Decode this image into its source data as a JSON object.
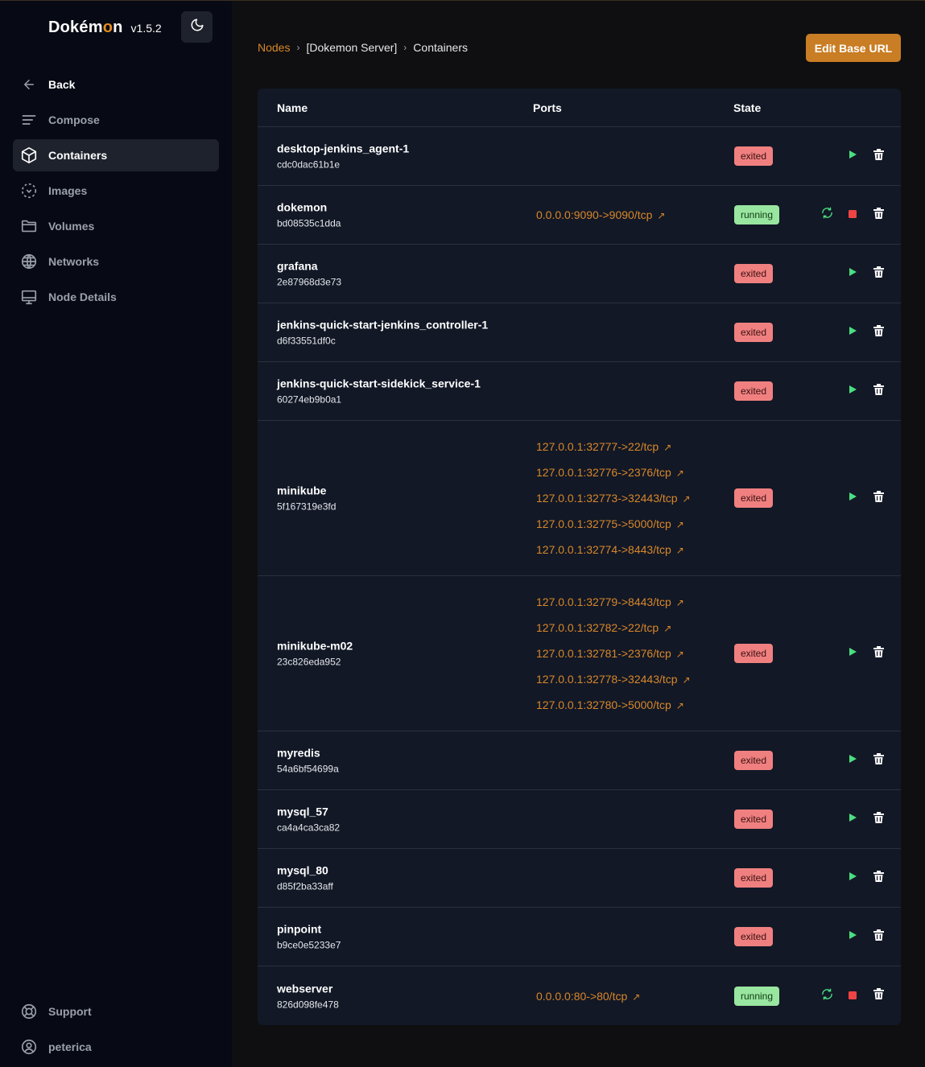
{
  "app": {
    "name_pre": "Dok",
    "name_accent": "é",
    "name_mid": "m",
    "name_o": "o",
    "name_post": "n",
    "version": "v1.5.2"
  },
  "colors": {
    "accent": "#d8872a",
    "exited": "#f08080",
    "running": "#99e6a0",
    "play": "#4ade80",
    "stop": "#ef4444"
  },
  "sidebar": {
    "items": [
      {
        "label": "Back",
        "icon": "arrow-left-icon"
      },
      {
        "label": "Compose",
        "icon": "lines-icon"
      },
      {
        "label": "Containers",
        "icon": "cube-icon",
        "active": true
      },
      {
        "label": "Images",
        "icon": "dashed-image-icon"
      },
      {
        "label": "Volumes",
        "icon": "folder-icon"
      },
      {
        "label": "Networks",
        "icon": "globe-icon"
      },
      {
        "label": "Node Details",
        "icon": "monitor-icon"
      }
    ],
    "bottom": [
      {
        "label": "Support",
        "icon": "lifebuoy-icon"
      },
      {
        "label": "peterica",
        "icon": "user-circle-icon"
      }
    ]
  },
  "breadcrumb": {
    "nodes": "Nodes",
    "server": "[Dokemon Server]",
    "current": "Containers"
  },
  "edit_button": "Edit Base URL",
  "table": {
    "headers": {
      "name": "Name",
      "ports": "Ports",
      "state": "State"
    },
    "rows": [
      {
        "name": "desktop-jenkins_agent-1",
        "id": "cdc0dac61b1e",
        "ports": [],
        "state": "exited"
      },
      {
        "name": "dokemon",
        "id": "bd08535c1dda",
        "ports": [
          "0.0.0.0:9090->9090/tcp"
        ],
        "state": "running"
      },
      {
        "name": "grafana",
        "id": "2e87968d3e73",
        "ports": [],
        "state": "exited"
      },
      {
        "name": "jenkins-quick-start-jenkins_controller-1",
        "id": "d6f33551df0c",
        "ports": [],
        "state": "exited"
      },
      {
        "name": "jenkins-quick-start-sidekick_service-1",
        "id": "60274eb9b0a1",
        "ports": [],
        "state": "exited"
      },
      {
        "name": "minikube",
        "id": "5f167319e3fd",
        "ports": [
          "127.0.0.1:32777->22/tcp",
          "127.0.0.1:32776->2376/tcp",
          "127.0.0.1:32773->32443/tcp",
          "127.0.0.1:32775->5000/tcp",
          "127.0.0.1:32774->8443/tcp"
        ],
        "state": "exited"
      },
      {
        "name": "minikube-m02",
        "id": "23c826eda952",
        "ports": [
          "127.0.0.1:32779->8443/tcp",
          "127.0.0.1:32782->22/tcp",
          "127.0.0.1:32781->2376/tcp",
          "127.0.0.1:32778->32443/tcp",
          "127.0.0.1:32780->5000/tcp"
        ],
        "state": "exited"
      },
      {
        "name": "myredis",
        "id": "54a6bf54699a",
        "ports": [],
        "state": "exited"
      },
      {
        "name": "mysql_57",
        "id": "ca4a4ca3ca82",
        "ports": [],
        "state": "exited"
      },
      {
        "name": "mysql_80",
        "id": "d85f2ba33aff",
        "ports": [],
        "state": "exited"
      },
      {
        "name": "pinpoint",
        "id": "b9ce0e5233e7",
        "ports": [],
        "state": "exited"
      },
      {
        "name": "webserver",
        "id": "826d098fe478",
        "ports": [
          "0.0.0.0:80->80/tcp"
        ],
        "state": "running"
      }
    ]
  }
}
